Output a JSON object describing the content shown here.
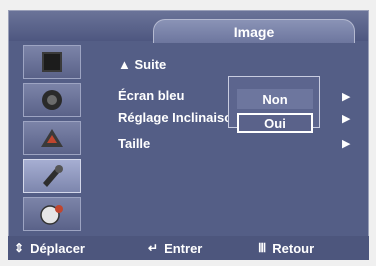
{
  "header": {
    "title": "Image"
  },
  "sidebar": {
    "items": [
      {
        "icon": "tv-screen-icon"
      },
      {
        "icon": "speaker-icon"
      },
      {
        "icon": "satellite-dish-icon"
      },
      {
        "icon": "settings-tools-icon"
      },
      {
        "icon": "globe-gear-icon"
      }
    ]
  },
  "menu": {
    "suite": "▲ Suite",
    "ecran_bleu": "Écran bleu",
    "colon": ":",
    "reglage": "Réglage Inclinaiso",
    "taille": "Taille",
    "arrow": "▶"
  },
  "dropdown": {
    "options": [
      "Non",
      "Oui"
    ]
  },
  "footer": {
    "move_icon": "⇕",
    "move": "Déplacer",
    "enter_icon": "↵",
    "enter": "Entrer",
    "return_icon": "Ⅲ",
    "return": "Retour"
  }
}
